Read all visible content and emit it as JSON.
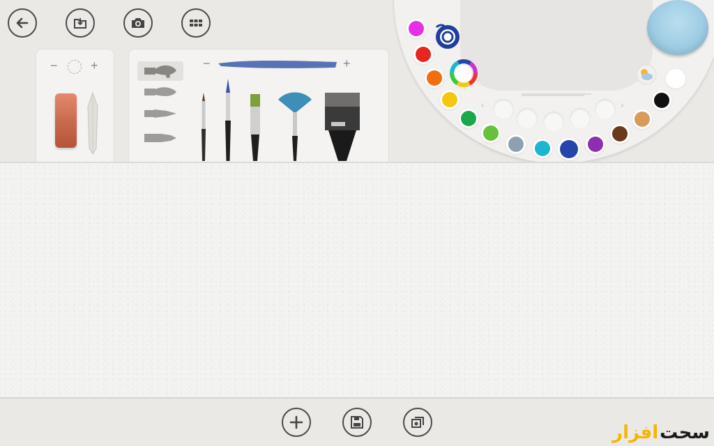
{
  "top_actions": [
    {
      "name": "back-button",
      "icon": "back-arrow-icon"
    },
    {
      "name": "import-button",
      "icon": "import-folder-icon"
    },
    {
      "name": "camera-button",
      "icon": "camera-icon"
    },
    {
      "name": "gallery-button",
      "icon": "grid-icon"
    }
  ],
  "eraser_panel": {
    "minus": "−",
    "plus": "+"
  },
  "brush_panel": {
    "minus": "−",
    "plus": "+",
    "stroke_color": "#3d5aa8"
  },
  "palette": {
    "selected_color": "#2446a8",
    "colors": [
      "#e62ee6",
      "#e8251f",
      "#f26d10",
      "#f5c80f",
      "#1aa84a",
      "#66c23a",
      "#8fa1b1",
      "#1ab7cf",
      "#2446a8",
      "#8c2fb0",
      "#6b3a18",
      "#d99a5c",
      "#111111",
      "#ffffff"
    ]
  },
  "bottom_actions": [
    {
      "name": "add-button",
      "icon": "plus-icon"
    },
    {
      "name": "save-button",
      "icon": "save-disk-icon"
    },
    {
      "name": "share-button",
      "icon": "share-photos-icon"
    }
  ],
  "watermark": {
    "part1": "سحت",
    "part2": "افزار"
  }
}
